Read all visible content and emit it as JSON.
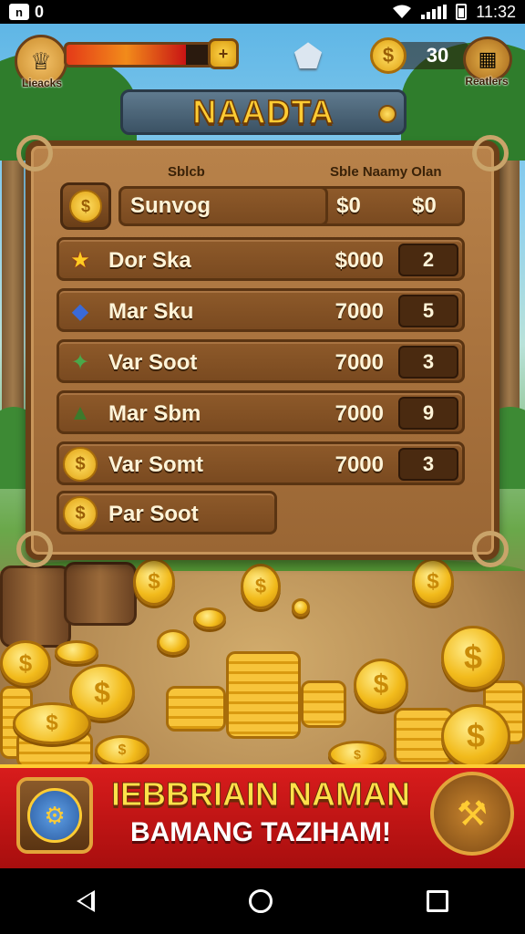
{
  "status_bar": {
    "notification_icon": "n-icon",
    "notification_text": "0",
    "time": "11:32"
  },
  "hud": {
    "avatar_label": "Lieacks",
    "hp_fraction": 0.8,
    "plus_label": "+",
    "coin_count": "30",
    "chest_label": "Reatlers"
  },
  "title": {
    "text": "NAADTA"
  },
  "board": {
    "header_left": "Sblcb",
    "header_right": "Sble Naamy Olan",
    "search": {
      "value": "Sunvog",
      "money_a": "$0",
      "money_b": "$0"
    },
    "items": [
      {
        "icon": "star-icon",
        "name": "Dor Ska",
        "price": "$000",
        "qty": "2"
      },
      {
        "icon": "kite-icon",
        "name": "Mar Sku",
        "price": "7000",
        "qty": "5"
      },
      {
        "icon": "star-gem-icon",
        "name": "Var Soot",
        "price": "7000",
        "qty": "3"
      },
      {
        "icon": "helmet-icon",
        "name": "Mar Sbm",
        "price": "7000",
        "qty": "9"
      },
      {
        "icon": "coin-icon",
        "name": "Var Somt",
        "price": "7000",
        "qty": "3"
      }
    ],
    "extra_item": {
      "icon": "coin-icon",
      "name": "Par Soot"
    }
  },
  "banner": {
    "line1": "IEBBRIAIN NAMAN",
    "line2": "BAMANG TAZIHAM!"
  },
  "colors": {
    "banner_red": "#d81c1c",
    "gold": "#ffcc33",
    "wood": "#a9733e"
  }
}
